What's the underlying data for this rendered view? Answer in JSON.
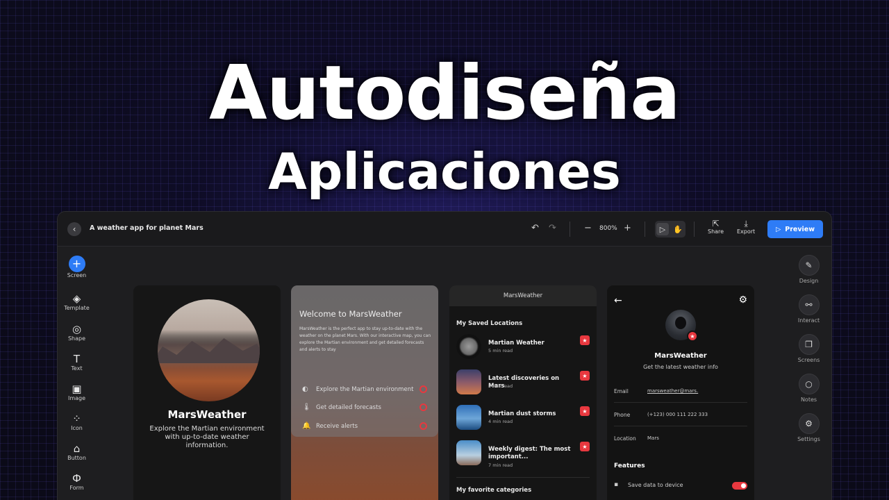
{
  "headline": {
    "line1": "Autodiseña",
    "line2": "Aplicaciones"
  },
  "editor": {
    "doc_title": "A weather app for planet Mars",
    "zoom": "800%",
    "share_label": "Share",
    "export_label": "Export",
    "preview_label": "Preview",
    "left_tools": [
      "Screen",
      "Template",
      "Shape",
      "Text",
      "Image",
      "Icon",
      "Button",
      "Form"
    ],
    "right_tools": [
      "Design",
      "Interact",
      "Screens",
      "Notes",
      "Settings"
    ]
  },
  "screen1": {
    "app_name": "MarsWeather",
    "description": "Explore the Martian environment with up-to-date weather information."
  },
  "screen2": {
    "title": "Welcome to MarsWeather",
    "body": "MarsWeather is the perfect app to stay up-to-date with the weather on the planet Mars. With our interactive map, you can explore the Martian environment and get detailed forecasts and alerts to stay",
    "features": [
      "Explore the Martian environment",
      "Get detailed forecasts",
      "Receive alerts"
    ]
  },
  "screen3": {
    "header": "MarsWeather",
    "section1": "My Saved Locations",
    "items": [
      {
        "title": "Martian Weather",
        "meta": "5 min read"
      },
      {
        "title": "Latest discoveries on Mars",
        "meta": "2 min read"
      },
      {
        "title": "Martian dust storms",
        "meta": "4 min read"
      },
      {
        "title": "Weekly digest: The most important...",
        "meta": "7 min read"
      }
    ],
    "section2": "My favorite categories"
  },
  "screen4": {
    "name": "MarsWeather",
    "subtitle": "Get the latest weather info",
    "email_label": "Email",
    "email_value": "marsweather@mars.",
    "phone_label": "Phone",
    "phone_value": "(+123) 000 111 222 333",
    "location_label": "Location",
    "location_value": "Mars",
    "features_label": "Features",
    "setting_label": "Save data to device"
  },
  "colors": {
    "accent_blue": "#2e7cf6",
    "accent_red": "#e8383f",
    "panel": "#1e1e20"
  }
}
